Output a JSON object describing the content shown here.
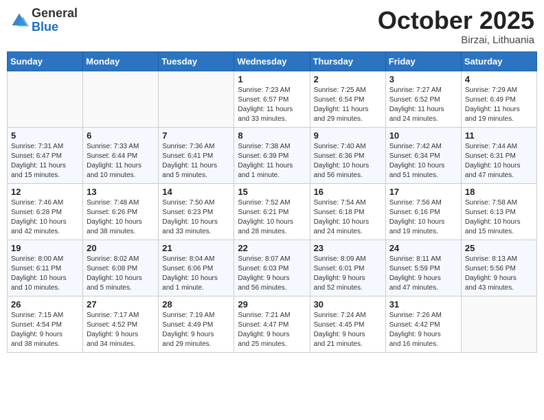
{
  "header": {
    "logo_general": "General",
    "logo_blue": "Blue",
    "month_title": "October 2025",
    "location": "Birzai, Lithuania"
  },
  "days_of_week": [
    "Sunday",
    "Monday",
    "Tuesday",
    "Wednesday",
    "Thursday",
    "Friday",
    "Saturday"
  ],
  "weeks": [
    [
      {
        "day": "",
        "info": ""
      },
      {
        "day": "",
        "info": ""
      },
      {
        "day": "",
        "info": ""
      },
      {
        "day": "1",
        "info": "Sunrise: 7:23 AM\nSunset: 6:57 PM\nDaylight: 11 hours\nand 33 minutes."
      },
      {
        "day": "2",
        "info": "Sunrise: 7:25 AM\nSunset: 6:54 PM\nDaylight: 11 hours\nand 29 minutes."
      },
      {
        "day": "3",
        "info": "Sunrise: 7:27 AM\nSunset: 6:52 PM\nDaylight: 11 hours\nand 24 minutes."
      },
      {
        "day": "4",
        "info": "Sunrise: 7:29 AM\nSunset: 6:49 PM\nDaylight: 11 hours\nand 19 minutes."
      }
    ],
    [
      {
        "day": "5",
        "info": "Sunrise: 7:31 AM\nSunset: 6:47 PM\nDaylight: 11 hours\nand 15 minutes."
      },
      {
        "day": "6",
        "info": "Sunrise: 7:33 AM\nSunset: 6:44 PM\nDaylight: 11 hours\nand 10 minutes."
      },
      {
        "day": "7",
        "info": "Sunrise: 7:36 AM\nSunset: 6:41 PM\nDaylight: 11 hours\nand 5 minutes."
      },
      {
        "day": "8",
        "info": "Sunrise: 7:38 AM\nSunset: 6:39 PM\nDaylight: 11 hours\nand 1 minute."
      },
      {
        "day": "9",
        "info": "Sunrise: 7:40 AM\nSunset: 6:36 PM\nDaylight: 10 hours\nand 56 minutes."
      },
      {
        "day": "10",
        "info": "Sunrise: 7:42 AM\nSunset: 6:34 PM\nDaylight: 10 hours\nand 51 minutes."
      },
      {
        "day": "11",
        "info": "Sunrise: 7:44 AM\nSunset: 6:31 PM\nDaylight: 10 hours\nand 47 minutes."
      }
    ],
    [
      {
        "day": "12",
        "info": "Sunrise: 7:46 AM\nSunset: 6:28 PM\nDaylight: 10 hours\nand 42 minutes."
      },
      {
        "day": "13",
        "info": "Sunrise: 7:48 AM\nSunset: 6:26 PM\nDaylight: 10 hours\nand 38 minutes."
      },
      {
        "day": "14",
        "info": "Sunrise: 7:50 AM\nSunset: 6:23 PM\nDaylight: 10 hours\nand 33 minutes."
      },
      {
        "day": "15",
        "info": "Sunrise: 7:52 AM\nSunset: 6:21 PM\nDaylight: 10 hours\nand 28 minutes."
      },
      {
        "day": "16",
        "info": "Sunrise: 7:54 AM\nSunset: 6:18 PM\nDaylight: 10 hours\nand 24 minutes."
      },
      {
        "day": "17",
        "info": "Sunrise: 7:56 AM\nSunset: 6:16 PM\nDaylight: 10 hours\nand 19 minutes."
      },
      {
        "day": "18",
        "info": "Sunrise: 7:58 AM\nSunset: 6:13 PM\nDaylight: 10 hours\nand 15 minutes."
      }
    ],
    [
      {
        "day": "19",
        "info": "Sunrise: 8:00 AM\nSunset: 6:11 PM\nDaylight: 10 hours\nand 10 minutes."
      },
      {
        "day": "20",
        "info": "Sunrise: 8:02 AM\nSunset: 6:08 PM\nDaylight: 10 hours\nand 5 minutes."
      },
      {
        "day": "21",
        "info": "Sunrise: 8:04 AM\nSunset: 6:06 PM\nDaylight: 10 hours\nand 1 minute."
      },
      {
        "day": "22",
        "info": "Sunrise: 8:07 AM\nSunset: 6:03 PM\nDaylight: 9 hours\nand 56 minutes."
      },
      {
        "day": "23",
        "info": "Sunrise: 8:09 AM\nSunset: 6:01 PM\nDaylight: 9 hours\nand 52 minutes."
      },
      {
        "day": "24",
        "info": "Sunrise: 8:11 AM\nSunset: 5:59 PM\nDaylight: 9 hours\nand 47 minutes."
      },
      {
        "day": "25",
        "info": "Sunrise: 8:13 AM\nSunset: 5:56 PM\nDaylight: 9 hours\nand 43 minutes."
      }
    ],
    [
      {
        "day": "26",
        "info": "Sunrise: 7:15 AM\nSunset: 4:54 PM\nDaylight: 9 hours\nand 38 minutes."
      },
      {
        "day": "27",
        "info": "Sunrise: 7:17 AM\nSunset: 4:52 PM\nDaylight: 9 hours\nand 34 minutes."
      },
      {
        "day": "28",
        "info": "Sunrise: 7:19 AM\nSunset: 4:49 PM\nDaylight: 9 hours\nand 29 minutes."
      },
      {
        "day": "29",
        "info": "Sunrise: 7:21 AM\nSunset: 4:47 PM\nDaylight: 9 hours\nand 25 minutes."
      },
      {
        "day": "30",
        "info": "Sunrise: 7:24 AM\nSunset: 4:45 PM\nDaylight: 9 hours\nand 21 minutes."
      },
      {
        "day": "31",
        "info": "Sunrise: 7:26 AM\nSunset: 4:42 PM\nDaylight: 9 hours\nand 16 minutes."
      },
      {
        "day": "",
        "info": ""
      }
    ]
  ]
}
